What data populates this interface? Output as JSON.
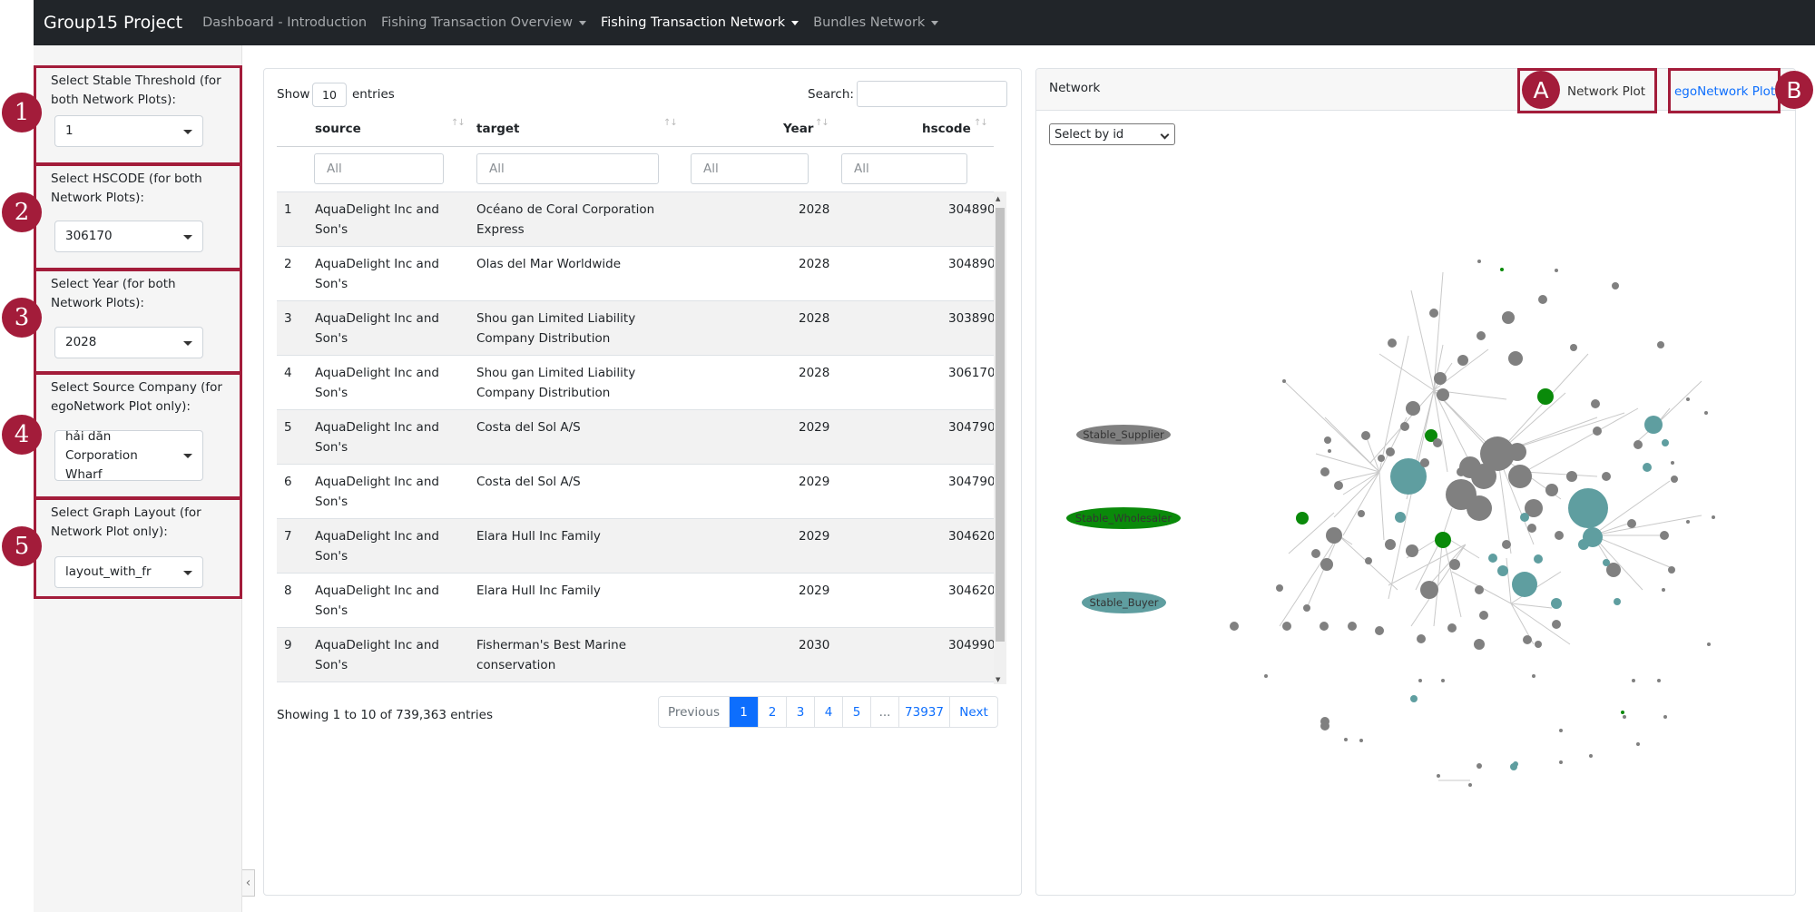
{
  "navbar": {
    "brand": "Group15 Project",
    "items": [
      {
        "label": "Dashboard - Introduction"
      },
      {
        "label": "Fishing Transaction Overview"
      },
      {
        "label": "Fishing Transaction Network"
      },
      {
        "label": "Bundles Network"
      }
    ]
  },
  "sidebar": {
    "controls": [
      {
        "number": "1",
        "label": "Select Stable Threshold (for both Network Plots):",
        "value": "1"
      },
      {
        "number": "2",
        "label": "Select HSCODE (for both Network Plots):",
        "value": "306170"
      },
      {
        "number": "3",
        "label": "Select Year (for both Network Plots):",
        "value": "2028"
      },
      {
        "number": "4",
        "label": "Select Source Company (for egoNetwork Plot only):",
        "value": "hải dăn Corporation Wharf"
      },
      {
        "number": "5",
        "label": "Select Graph Layout (for Network Plot only):",
        "value": "layout_with_fr"
      }
    ],
    "collapse_glyph": "‹"
  },
  "table": {
    "show_label": "Show",
    "entries_value": "10",
    "entries_label": "entries",
    "search_label": "Search:",
    "columns": [
      "source",
      "target",
      "Year",
      "hscode"
    ],
    "filter_placeholder": "All",
    "rows": [
      {
        "n": "1",
        "source": [
          "AquaDelight Inc and",
          "Son's"
        ],
        "target": [
          "Océano de Coral Corporation",
          "Express"
        ],
        "year": "2028",
        "hscode": "304890"
      },
      {
        "n": "2",
        "source": [
          "AquaDelight Inc and",
          "Son's"
        ],
        "target": [
          "Olas del Mar Worldwide",
          ""
        ],
        "year": "2028",
        "hscode": "304890"
      },
      {
        "n": "3",
        "source": [
          "AquaDelight Inc and",
          "Son's"
        ],
        "target": [
          "Shou gan Limited Liability",
          "Company Distribution"
        ],
        "year": "2028",
        "hscode": "303890"
      },
      {
        "n": "4",
        "source": [
          "AquaDelight Inc and",
          "Son's"
        ],
        "target": [
          "Shou gan Limited Liability",
          "Company Distribution"
        ],
        "year": "2028",
        "hscode": "306170"
      },
      {
        "n": "5",
        "source": [
          "AquaDelight Inc and",
          "Son's"
        ],
        "target": [
          "Costa del Sol A/S",
          ""
        ],
        "year": "2029",
        "hscode": "304790"
      },
      {
        "n": "6",
        "source": [
          "AquaDelight Inc and",
          "Son's"
        ],
        "target": [
          "Costa del Sol A/S",
          ""
        ],
        "year": "2029",
        "hscode": "304790"
      },
      {
        "n": "7",
        "source": [
          "AquaDelight Inc and",
          "Son's"
        ],
        "target": [
          "Elara Hull Inc Family",
          ""
        ],
        "year": "2029",
        "hscode": "304620"
      },
      {
        "n": "8",
        "source": [
          "AquaDelight Inc and",
          "Son's"
        ],
        "target": [
          "Elara Hull Inc Family",
          ""
        ],
        "year": "2029",
        "hscode": "304620"
      },
      {
        "n": "9",
        "source": [
          "AquaDelight Inc and",
          "Son's"
        ],
        "target": [
          "Fisherman's Best Marine",
          "conservation"
        ],
        "year": "2030",
        "hscode": "304990"
      }
    ],
    "info": "Showing 1 to 10 of 739,363 entries",
    "pager": [
      "Previous",
      "1",
      "2",
      "3",
      "4",
      "5",
      "...",
      "73937",
      "Next"
    ]
  },
  "network": {
    "title": "Network",
    "tabs": [
      {
        "letter": "A",
        "label": "Network Plot"
      },
      {
        "letter": "B",
        "label": "egoNetwork Plot"
      }
    ],
    "select_label": "Select by id",
    "legend": [
      {
        "label": "Stable_Supplier",
        "color": "#808080"
      },
      {
        "label": "Stable_Wholesaler",
        "color": "#0a8a0a"
      },
      {
        "label": "Stable_Buyer",
        "color": "#5f9ea0"
      }
    ],
    "colors": {
      "supplier": "#808080",
      "wholesaler": "#0a8a0a",
      "buyer": "#5f9ea0",
      "accent": "#a31c3a",
      "link": "#0d6efd"
    }
  }
}
